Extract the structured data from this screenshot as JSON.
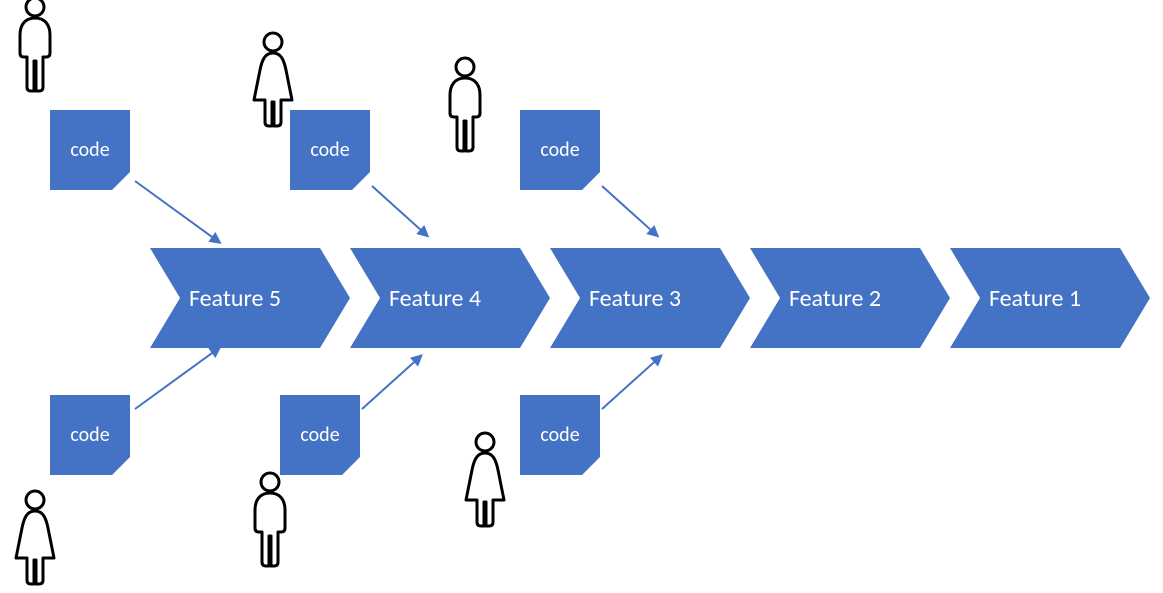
{
  "colors": {
    "accent": "#4472C4"
  },
  "code_label": "code",
  "features": {
    "f5": "Feature 5",
    "f4": "Feature 4",
    "f3": "Feature 3",
    "f2": "Feature 2",
    "f1": "Feature 1"
  },
  "top_contributors": [
    {
      "icon": "person-male",
      "note": "code",
      "feeds": "f5"
    },
    {
      "icon": "person-female",
      "note": "code",
      "feeds": "f4"
    },
    {
      "icon": "person-male",
      "note": "code",
      "feeds": "f3"
    }
  ],
  "bottom_contributors": [
    {
      "icon": "person-female",
      "note": "code",
      "feeds": "f5"
    },
    {
      "icon": "person-male",
      "note": "code",
      "feeds": "f4"
    },
    {
      "icon": "person-female",
      "note": "code",
      "feeds": "f3"
    }
  ]
}
